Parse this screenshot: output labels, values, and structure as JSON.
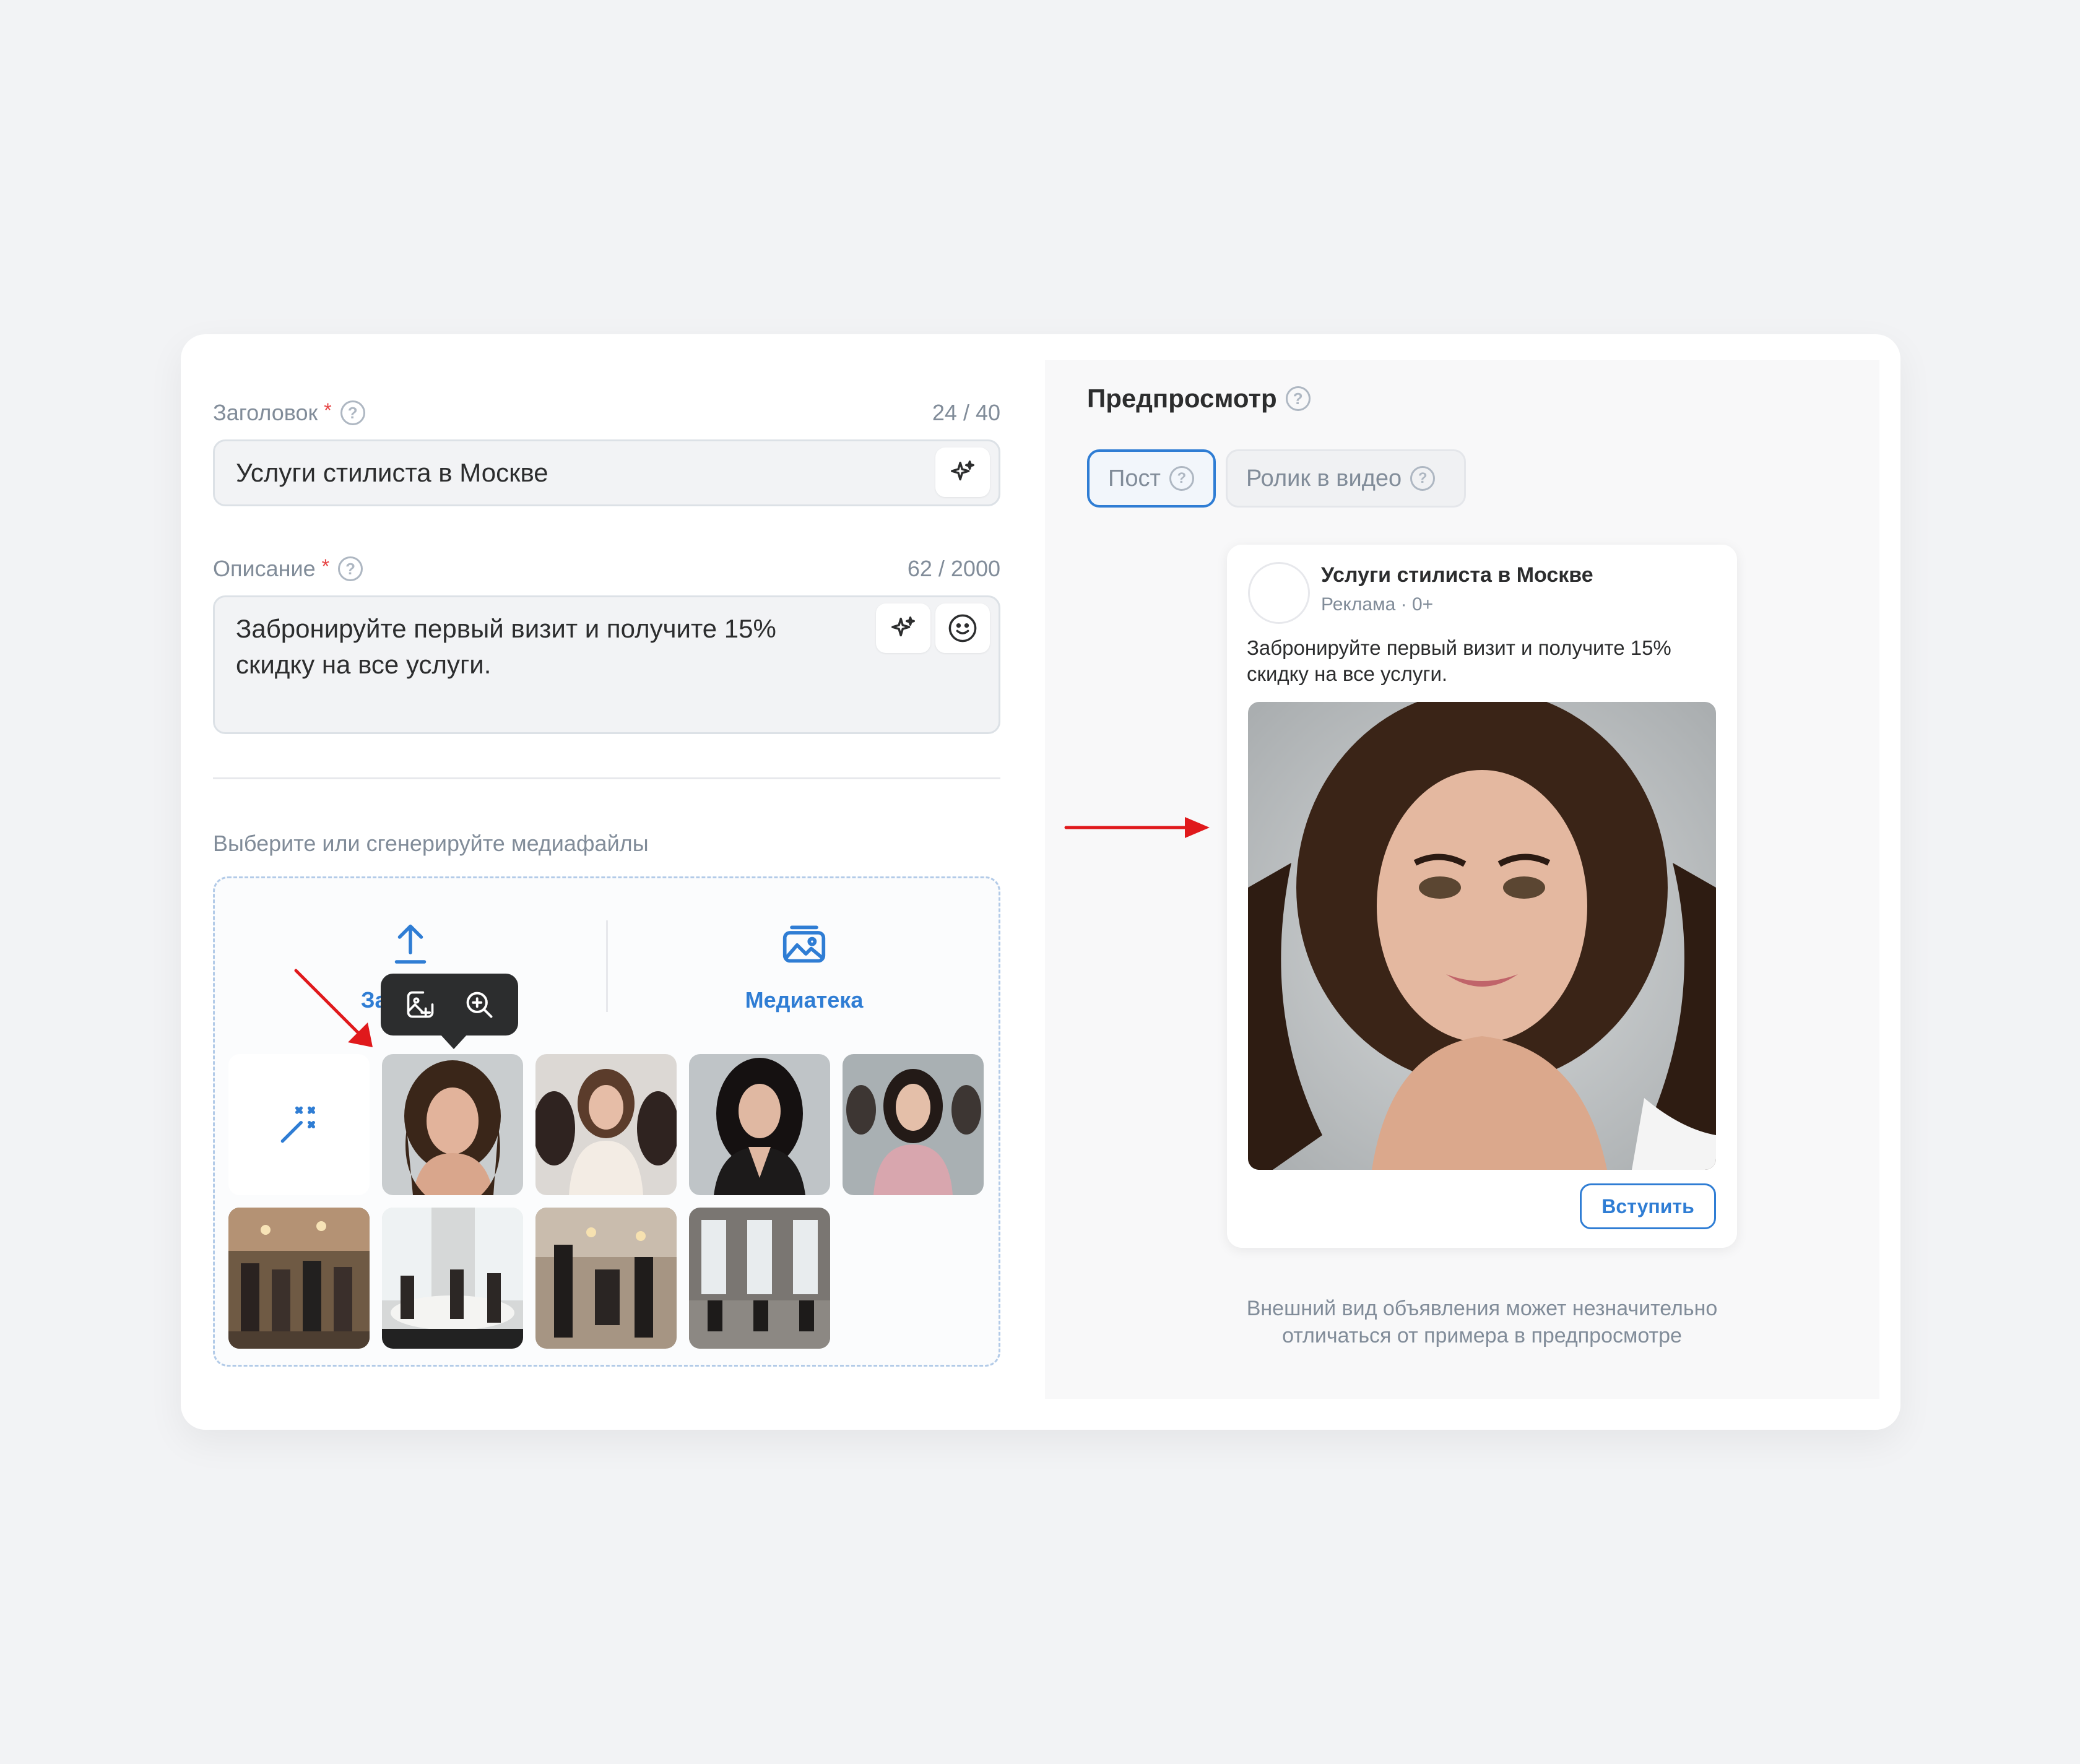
{
  "form": {
    "title_field": {
      "label": "Заголовок",
      "required_mark": "*",
      "counter": "24 / 40",
      "value": "Услуги стилиста в Москве"
    },
    "description_field": {
      "label": "Описание",
      "required_mark": "*",
      "counter": "62 / 2000",
      "value_line1": "Забронируйте первый визит и получите 15%",
      "value_line2": "скидку на все услуги."
    },
    "help_glyph": "?",
    "media": {
      "caption": "Выберите или сгенерируйте медиафайлы",
      "upload_label_visible": "За",
      "library_label": "Медиатека"
    }
  },
  "preview": {
    "title": "Предпросмотр",
    "tabs": [
      {
        "label": "Пост",
        "active": true
      },
      {
        "label": "Ролик в видео",
        "active": false
      }
    ],
    "post": {
      "name": "Услуги стилиста в Москве",
      "meta": "Реклама · 0+",
      "text": "Забронируйте первый визит и получите 15% скидку на все услуги.",
      "button_label": "Вступить"
    },
    "disclaimer_line1": "Внешний вид объявления может незначительно",
    "disclaimer_line2": "отличаться от примера в предпросмотре"
  },
  "colors": {
    "accent": "#2f7dd4",
    "annotation_arrow": "#e0191c",
    "required": "#e64646"
  }
}
